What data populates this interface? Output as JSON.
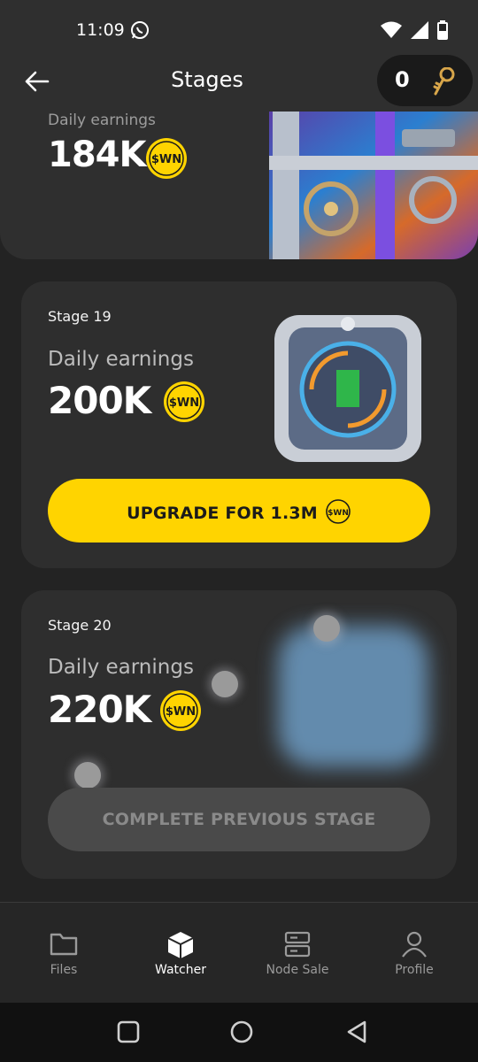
{
  "status": {
    "time": "11:09"
  },
  "header": {
    "title": "Stages",
    "keys_count": "0"
  },
  "currency": "$WN",
  "stages": [
    {
      "daily_label": "Daily earnings",
      "daily_value": "184K"
    },
    {
      "stage_label": "Stage 19",
      "daily_label": "Daily earnings",
      "daily_value": "200K",
      "button_label": "UPGRADE FOR 1.3M",
      "button_state": "enabled"
    },
    {
      "stage_label": "Stage 20",
      "daily_label": "Daily earnings",
      "daily_value": "220K",
      "button_label": "COMPLETE PREVIOUS STAGE",
      "button_state": "disabled"
    }
  ],
  "nav": {
    "items": [
      {
        "label": "Files",
        "icon": "folder-icon"
      },
      {
        "label": "Watcher",
        "icon": "cube-icon",
        "active": true
      },
      {
        "label": "Node Sale",
        "icon": "server-icon"
      },
      {
        "label": "Profile",
        "icon": "person-icon"
      }
    ]
  },
  "colors": {
    "accent": "#ffd400",
    "background": "#232323",
    "card": "#2e2e2e",
    "disabled": "#4a4a4a"
  }
}
